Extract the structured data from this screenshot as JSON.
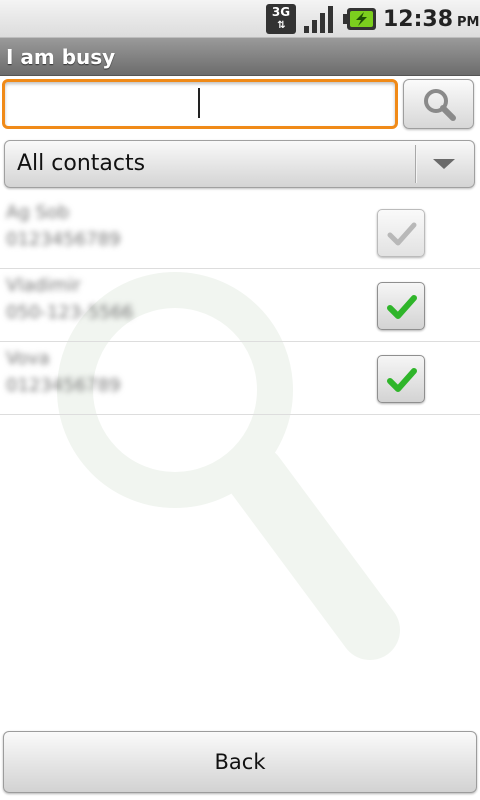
{
  "status_bar": {
    "network": "3G",
    "network_icon": "3g-data-icon",
    "signal_icon": "signal-strength-icon",
    "battery_icon": "battery-charging-icon",
    "time": "12:38",
    "ampm": "PM"
  },
  "title_bar": {
    "title": "I am busy"
  },
  "search": {
    "value": "",
    "placeholder": "",
    "button_icon": "search-icon"
  },
  "filter": {
    "selected": "All contacts"
  },
  "contacts": [
    {
      "name": "Ag Sob",
      "number": "0123456789",
      "checked": true,
      "enabled": false
    },
    {
      "name": "Vladimir",
      "number": "050-123-5566",
      "checked": true,
      "enabled": true
    },
    {
      "name": "Vova",
      "number": "0123456789",
      "checked": true,
      "enabled": true
    }
  ],
  "footer": {
    "back_label": "Back"
  },
  "colors": {
    "accent_focus": "#f08a18",
    "check_green": "#2fb52a",
    "title_bar": "#7a7a7a"
  }
}
